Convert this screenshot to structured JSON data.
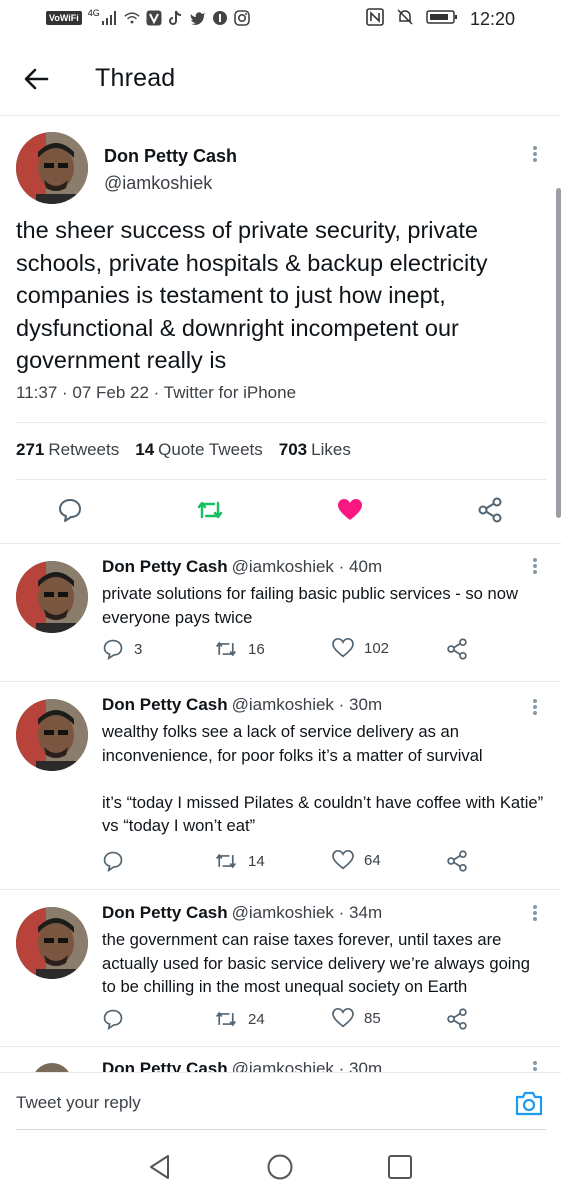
{
  "statusbar": {
    "vowifi": "VoWiFi",
    "network": "4G",
    "time": "12:20"
  },
  "header": {
    "title": "Thread"
  },
  "main_tweet": {
    "name": "Don Petty Cash",
    "handle": "@iamkoshiek",
    "text": "the sheer success of private security, private schools, private hospitals & backup electricity companies is testament to just how inept, dysfunctional & downright incompetent our government really is",
    "meta": "11:37 · 07 Feb 22 · Twitter for iPhone",
    "retweets_count": "271",
    "retweets_label": "Retweets",
    "quotes_count": "14",
    "quotes_label": "Quote Tweets",
    "likes_count": "703",
    "likes_label": "Likes",
    "colors": {
      "retweet": "#17bf63",
      "like": "#f91880"
    }
  },
  "replies": [
    {
      "name": "Don Petty Cash",
      "handle": "@iamkoshiek · 40m",
      "text": "private solutions for failing basic public services - so now everyone pays twice",
      "replies": "3",
      "retweets": "16",
      "likes": "102"
    },
    {
      "name": "Don Petty Cash",
      "handle": "@iamkoshiek · 30m",
      "text": "wealthy folks see a lack of service delivery as an inconvenience, for poor folks it’s a matter of survival\n\nit’s “today I missed Pilates & couldn’t have coffee with Katie” vs “today I won’t eat”",
      "replies": "",
      "retweets": "14",
      "likes": "64"
    },
    {
      "name": "Don Petty Cash",
      "handle": "@iamkoshiek · 34m",
      "text": "the government can raise taxes forever, until taxes are actually used for basic service delivery we’re always going to be chilling in the most unequal society on Earth",
      "replies": "",
      "retweets": "24",
      "likes": "85"
    },
    {
      "name": "Don Petty Cash",
      "handle": "@iamkoshiek · 30m"
    }
  ],
  "composer": {
    "placeholder": "Tweet your reply"
  }
}
